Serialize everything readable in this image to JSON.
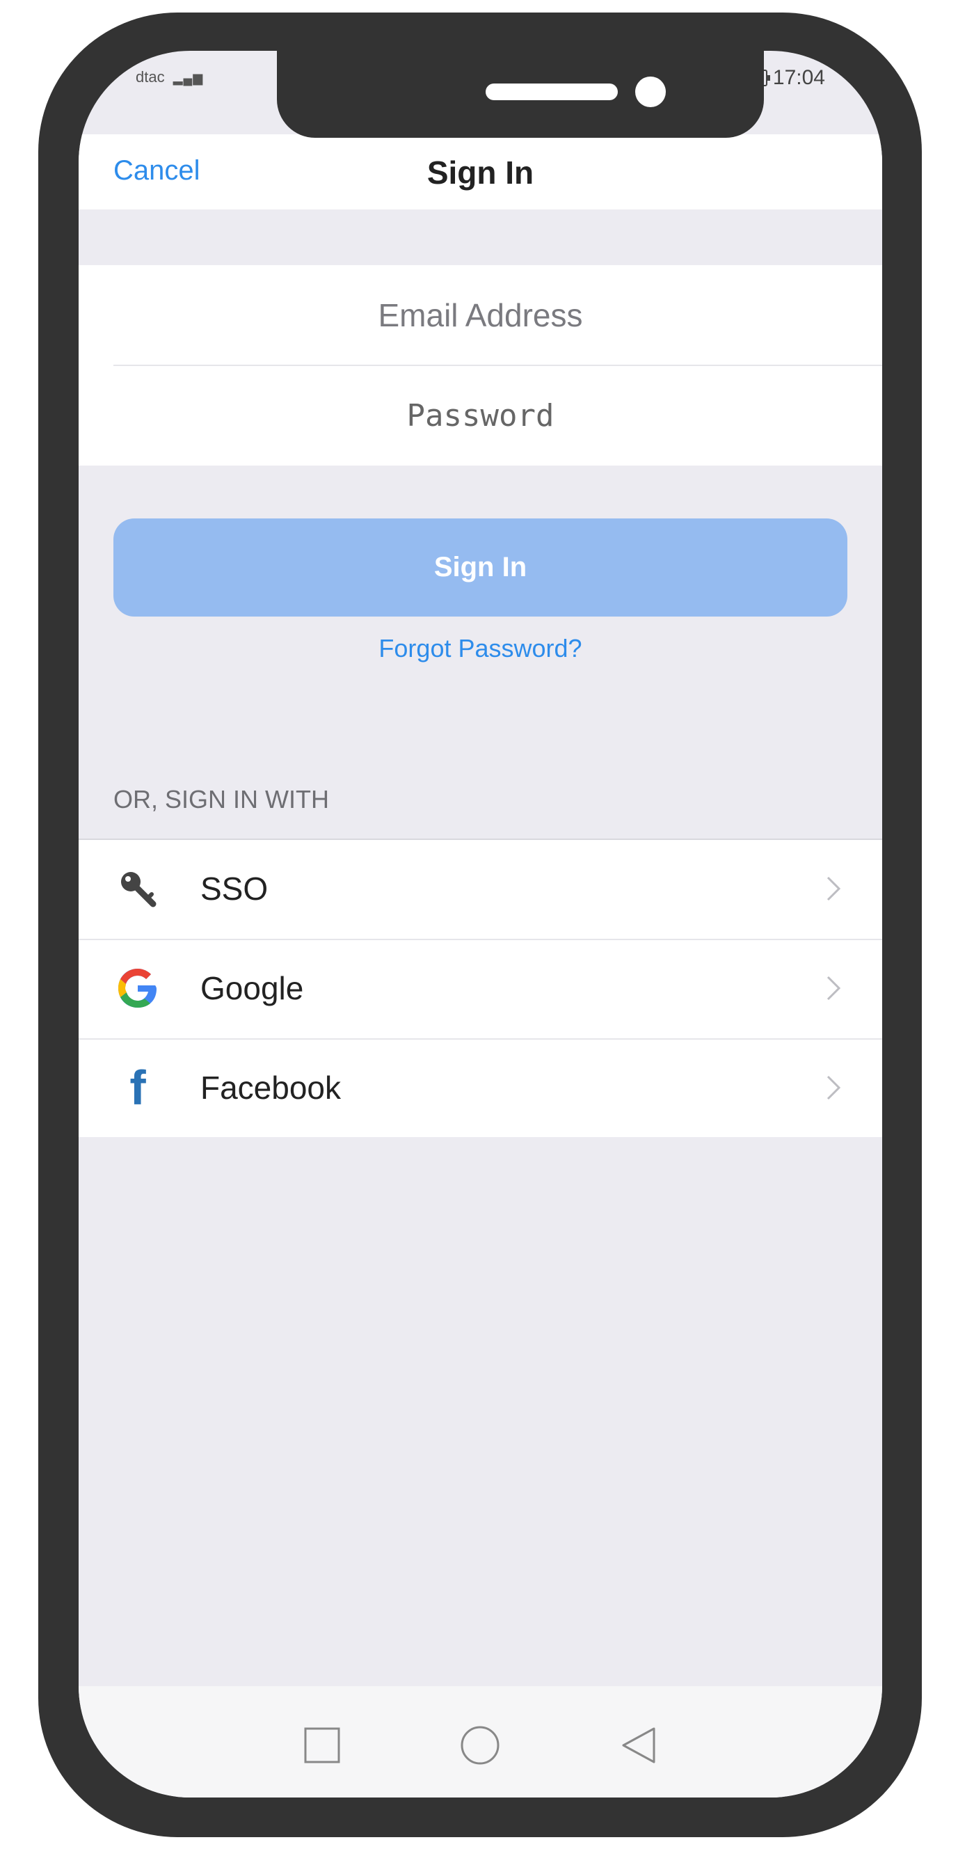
{
  "status_bar": {
    "carrier": "dtac",
    "time": "17:04"
  },
  "nav": {
    "cancel_label": "Cancel",
    "title": "Sign In"
  },
  "form": {
    "email_placeholder": "Email Address",
    "password_placeholder": "Password",
    "sign_in_label": "Sign In",
    "forgot_password_label": "Forgot Password?"
  },
  "social": {
    "section_label": "OR, SIGN IN WITH",
    "items": [
      {
        "label": "SSO",
        "icon": "key-icon"
      },
      {
        "label": "Google",
        "icon": "google-icon"
      },
      {
        "label": "Facebook",
        "icon": "facebook-icon"
      }
    ]
  },
  "colors": {
    "accent": "#2d8ceb",
    "button_disabled": "#95bbf0",
    "background": "#ecebf1",
    "frame": "#333333"
  },
  "android_nav": {
    "icons": [
      "square-icon",
      "circle-icon",
      "triangle-back-icon"
    ]
  }
}
